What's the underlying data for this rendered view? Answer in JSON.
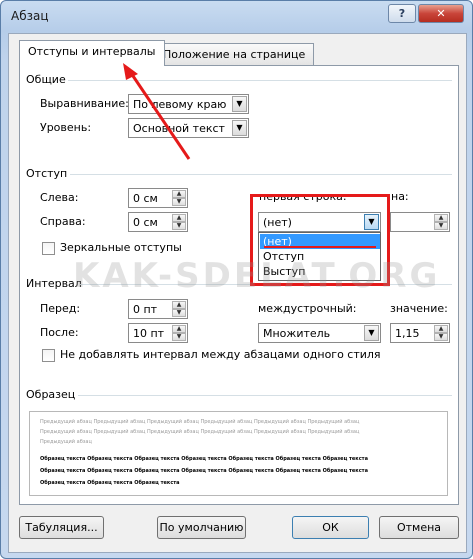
{
  "window": {
    "title": "Абзац",
    "help_label": "?",
    "close_label": "✕"
  },
  "tabs": [
    {
      "label": "Отступы и интервалы",
      "active": true
    },
    {
      "label": "Положение на странице",
      "active": false
    }
  ],
  "general": {
    "group_label": "Общие",
    "alignment_label": "Выравнивание:",
    "alignment_value": "По левому краю",
    "level_label": "Уровень:",
    "level_value": "Основной текст"
  },
  "indent": {
    "group_label": "Отступ",
    "left_label": "Слева:",
    "left_value": "0 см",
    "right_label": "Справа:",
    "right_value": "0 см",
    "first_line_label": "первая строка:",
    "first_line_value": "(нет)",
    "by_label": "на:",
    "by_value": "",
    "mirror_label": "Зеркальные отступы",
    "dropdown_options": [
      "(нет)",
      "Отступ",
      "Выступ"
    ],
    "dropdown_selected": 0
  },
  "spacing": {
    "group_label": "Интервал",
    "before_label": "Перед:",
    "before_value": "0 пт",
    "after_label": "После:",
    "after_value": "10 пт",
    "line_spacing_label": "междустрочный:",
    "line_spacing_value": "Множитель",
    "value_label": "значение:",
    "value_value": "1,15",
    "dont_add_label": "Не добавлять интервал между абзацами одного стиля"
  },
  "preview": {
    "group_label": "Образец",
    "previous_lines": [
      "Предыдущий абзац Предыдущий абзац Предыдущий абзац Предыдущий абзац Предыдущий абзац Предыдущий абзац",
      "Предыдущий абзац Предыдущий абзац Предыдущий абзац Предыдущий абзац Предыдущий абзац Предыдущий абзац",
      "Предыдущий абзац"
    ],
    "sample_lines": [
      "Образец текста Образец текста Образец текста Образец текста Образец текста Образец текста Образец текста",
      "Образец текста Образец текста Образец текста Образец текста Образец текста Образец текста Образец текста",
      "Образец текста Образец текста Образец текста"
    ]
  },
  "buttons": {
    "tabs": "Табуляция...",
    "default": "По умолчанию",
    "ok": "ОК",
    "cancel": "Отмена"
  },
  "watermark": "KAK-SDELAT.ORG",
  "annotation_color": "#e51a1a"
}
